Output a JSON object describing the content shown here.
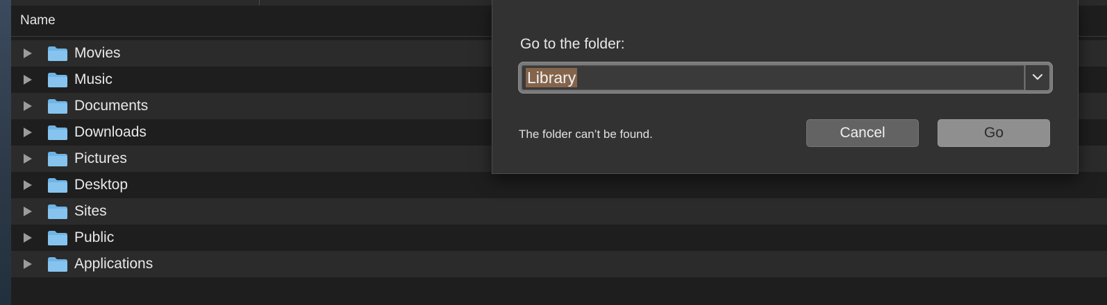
{
  "finder": {
    "column_header": "Name",
    "items": [
      {
        "label": "Movies"
      },
      {
        "label": "Music"
      },
      {
        "label": "Documents"
      },
      {
        "label": "Downloads"
      },
      {
        "label": "Pictures"
      },
      {
        "label": "Desktop"
      },
      {
        "label": "Sites"
      },
      {
        "label": "Public"
      },
      {
        "label": "Applications"
      }
    ]
  },
  "goto_sheet": {
    "prompt": "Go to the folder:",
    "path_value": "Library",
    "error_message": "The folder can’t be found.",
    "cancel_label": "Cancel",
    "go_label": "Go"
  },
  "colors": {
    "folder": "#6fb4e6",
    "selection": "#84644b"
  },
  "icons": {
    "disclosure": "disclosure-triangle-icon",
    "folder": "folder-icon",
    "dropdown": "chevron-down-icon"
  }
}
